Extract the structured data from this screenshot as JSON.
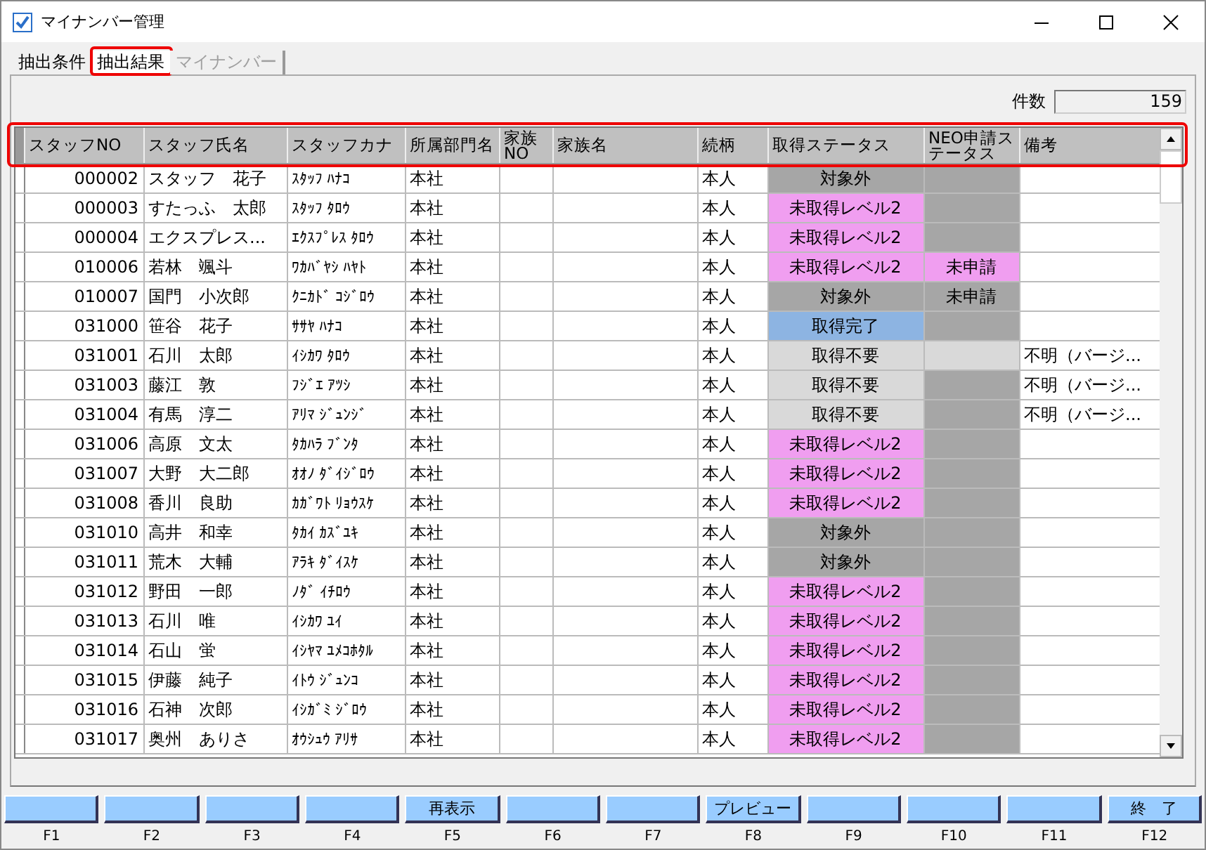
{
  "window": {
    "title": "マイナンバー管理"
  },
  "tabs": [
    {
      "label": "抽出条件",
      "selected": false,
      "disabled": false,
      "highlight": false
    },
    {
      "label": "抽出結果",
      "selected": true,
      "disabled": false,
      "highlight": true
    },
    {
      "label": "マイナンバー",
      "selected": false,
      "disabled": true,
      "highlight": false
    }
  ],
  "count": {
    "label": "件数",
    "value": "159"
  },
  "table": {
    "header_highlight": true,
    "columns": [
      "スタッフNO",
      "スタッフ氏名",
      "スタッフカナ",
      "所属部門名",
      "家族NO",
      "家族名",
      "続柄",
      "取得ステータス",
      "NEO申請ステータス",
      "備考"
    ],
    "rows": [
      {
        "no": "000002",
        "name": "スタッフ　花子",
        "kana": "ｽﾀｯﾌ ﾊﾅｺ",
        "dept": "本社",
        "relation": "本人",
        "status": {
          "text": "対象外",
          "color": "#a6a6a6"
        },
        "neo": {
          "color": "#a6a6a6"
        }
      },
      {
        "no": "000003",
        "name": "すたっふ　太郎",
        "kana": "ｽﾀｯﾌ ﾀﾛｳ",
        "dept": "本社",
        "relation": "本人",
        "status": {
          "text": "未取得レベル2",
          "color": "#f09ef0"
        },
        "neo": {
          "color": "#a6a6a6"
        }
      },
      {
        "no": "000004",
        "name": "エクスプレス...",
        "kana": "ｴｸｽﾌﾟﾚｽ ﾀﾛｳ",
        "dept": "本社",
        "relation": "本人",
        "status": {
          "text": "未取得レベル2",
          "color": "#f09ef0"
        },
        "neo": {
          "color": "#a6a6a6"
        }
      },
      {
        "no": "010006",
        "name": "若林　颯斗",
        "kana": "ﾜｶﾊﾞﾔｼ ﾊﾔﾄ",
        "dept": "本社",
        "relation": "本人",
        "status": {
          "text": "未取得レベル2",
          "color": "#f09ef0"
        },
        "neo": {
          "text": "未申請",
          "color": "#f09ef0"
        }
      },
      {
        "no": "010007",
        "name": "国門　小次郎",
        "kana": "ｸﾆｶﾄﾞ ｺｼﾞﾛｳ",
        "dept": "本社",
        "relation": "本人",
        "status": {
          "text": "対象外",
          "color": "#a6a6a6"
        },
        "neo": {
          "text": "未申請",
          "color": "#a6a6a6"
        }
      },
      {
        "no": "031000",
        "name": "笹谷　花子",
        "kana": "ｻｻﾔ ﾊﾅｺ",
        "dept": "本社",
        "relation": "本人",
        "status": {
          "text": "取得完了",
          "color": "#8db4e2"
        },
        "neo": {
          "color": "#a6a6a6"
        }
      },
      {
        "no": "031001",
        "name": "石川　太郎",
        "kana": "ｲｼｶﾜ ﾀﾛｳ",
        "dept": "本社",
        "relation": "本人",
        "status": {
          "text": "取得不要",
          "color": "#d9d9d9"
        },
        "neo": {
          "color": "#d9d9d9"
        },
        "remarks": "不明（バージ..."
      },
      {
        "no": "031003",
        "name": "藤江　敦",
        "kana": "ﾌｼﾞｴ ｱﾂｼ",
        "dept": "本社",
        "relation": "本人",
        "status": {
          "text": "取得不要",
          "color": "#d9d9d9"
        },
        "neo": {
          "color": "#a6a6a6"
        },
        "remarks": "不明（バージ..."
      },
      {
        "no": "031004",
        "name": "有馬　淳二",
        "kana": "ｱﾘﾏ ｼﾞｭﾝｼﾞ",
        "dept": "本社",
        "relation": "本人",
        "status": {
          "text": "取得不要",
          "color": "#d9d9d9"
        },
        "neo": {
          "color": "#a6a6a6"
        },
        "remarks": "不明（バージ..."
      },
      {
        "no": "031006",
        "name": "高原　文太",
        "kana": "ﾀｶﾊﾗ ﾌﾞﾝﾀ",
        "dept": "本社",
        "relation": "本人",
        "status": {
          "text": "未取得レベル2",
          "color": "#f09ef0"
        },
        "neo": {
          "color": "#a6a6a6"
        }
      },
      {
        "no": "031007",
        "name": "大野　大二郎",
        "kana": "ｵｵﾉ ﾀﾞｲｼﾞﾛｳ",
        "dept": "本社",
        "relation": "本人",
        "status": {
          "text": "未取得レベル2",
          "color": "#f09ef0"
        },
        "neo": {
          "color": "#a6a6a6"
        }
      },
      {
        "no": "031008",
        "name": "香川　良助",
        "kana": "ｶｶﾞﾜﾄ ﾘｮｳｽｹ",
        "dept": "本社",
        "relation": "本人",
        "status": {
          "text": "未取得レベル2",
          "color": "#f09ef0"
        },
        "neo": {
          "color": "#a6a6a6"
        }
      },
      {
        "no": "031010",
        "name": "高井　和幸",
        "kana": "ﾀｶｲ ｶｽﾞﾕｷ",
        "dept": "本社",
        "relation": "本人",
        "status": {
          "text": "対象外",
          "color": "#a6a6a6"
        },
        "neo": {
          "color": "#a6a6a6"
        }
      },
      {
        "no": "031011",
        "name": "荒木　大輔",
        "kana": "ｱﾗｷ ﾀﾞｲｽｹ",
        "dept": "本社",
        "relation": "本人",
        "status": {
          "text": "対象外",
          "color": "#a6a6a6"
        },
        "neo": {
          "color": "#a6a6a6"
        }
      },
      {
        "no": "031012",
        "name": "野田　一郎",
        "kana": "ﾉﾀﾞ ｲﾁﾛｳ",
        "dept": "本社",
        "relation": "本人",
        "status": {
          "text": "未取得レベル2",
          "color": "#f09ef0"
        },
        "neo": {
          "color": "#a6a6a6"
        }
      },
      {
        "no": "031013",
        "name": "石川　唯",
        "kana": "ｲｼｶﾜ ﾕｲ",
        "dept": "本社",
        "relation": "本人",
        "status": {
          "text": "未取得レベル2",
          "color": "#f09ef0"
        },
        "neo": {
          "color": "#a6a6a6"
        }
      },
      {
        "no": "031014",
        "name": "石山　蛍",
        "kana": "ｲｼﾔﾏ ﾕﾒｺﾎﾀﾙ",
        "dept": "本社",
        "relation": "本人",
        "status": {
          "text": "未取得レベル2",
          "color": "#f09ef0"
        },
        "neo": {
          "color": "#a6a6a6"
        }
      },
      {
        "no": "031015",
        "name": "伊藤　純子",
        "kana": "ｲﾄｳ ｼﾞｭﾝｺ",
        "dept": "本社",
        "relation": "本人",
        "status": {
          "text": "未取得レベル2",
          "color": "#f09ef0"
        },
        "neo": {
          "color": "#a6a6a6"
        }
      },
      {
        "no": "031016",
        "name": "石神　次郎",
        "kana": "ｲｼｶﾞﾐ ｼﾞﾛｳ",
        "dept": "本社",
        "relation": "本人",
        "status": {
          "text": "未取得レベル2",
          "color": "#f09ef0"
        },
        "neo": {
          "color": "#a6a6a6"
        }
      },
      {
        "no": "031017",
        "name": "奥州　ありさ",
        "kana": "ｵｳｼｭｳ ｱﾘｻ",
        "dept": "本社",
        "relation": "本人",
        "status": {
          "text": "未取得レベル2",
          "color": "#f09ef0"
        },
        "neo": {
          "color": "#a6a6a6"
        }
      }
    ]
  },
  "function_keys": [
    {
      "key": "F1"
    },
    {
      "key": "F2"
    },
    {
      "key": "F3"
    },
    {
      "key": "F4"
    },
    {
      "key": "F5",
      "label": "再表示"
    },
    {
      "key": "F6"
    },
    {
      "key": "F7"
    },
    {
      "key": "F8",
      "label": "プレビュー"
    },
    {
      "key": "F9"
    },
    {
      "key": "F10"
    },
    {
      "key": "F11"
    },
    {
      "key": "F12",
      "label": "終　了"
    }
  ]
}
